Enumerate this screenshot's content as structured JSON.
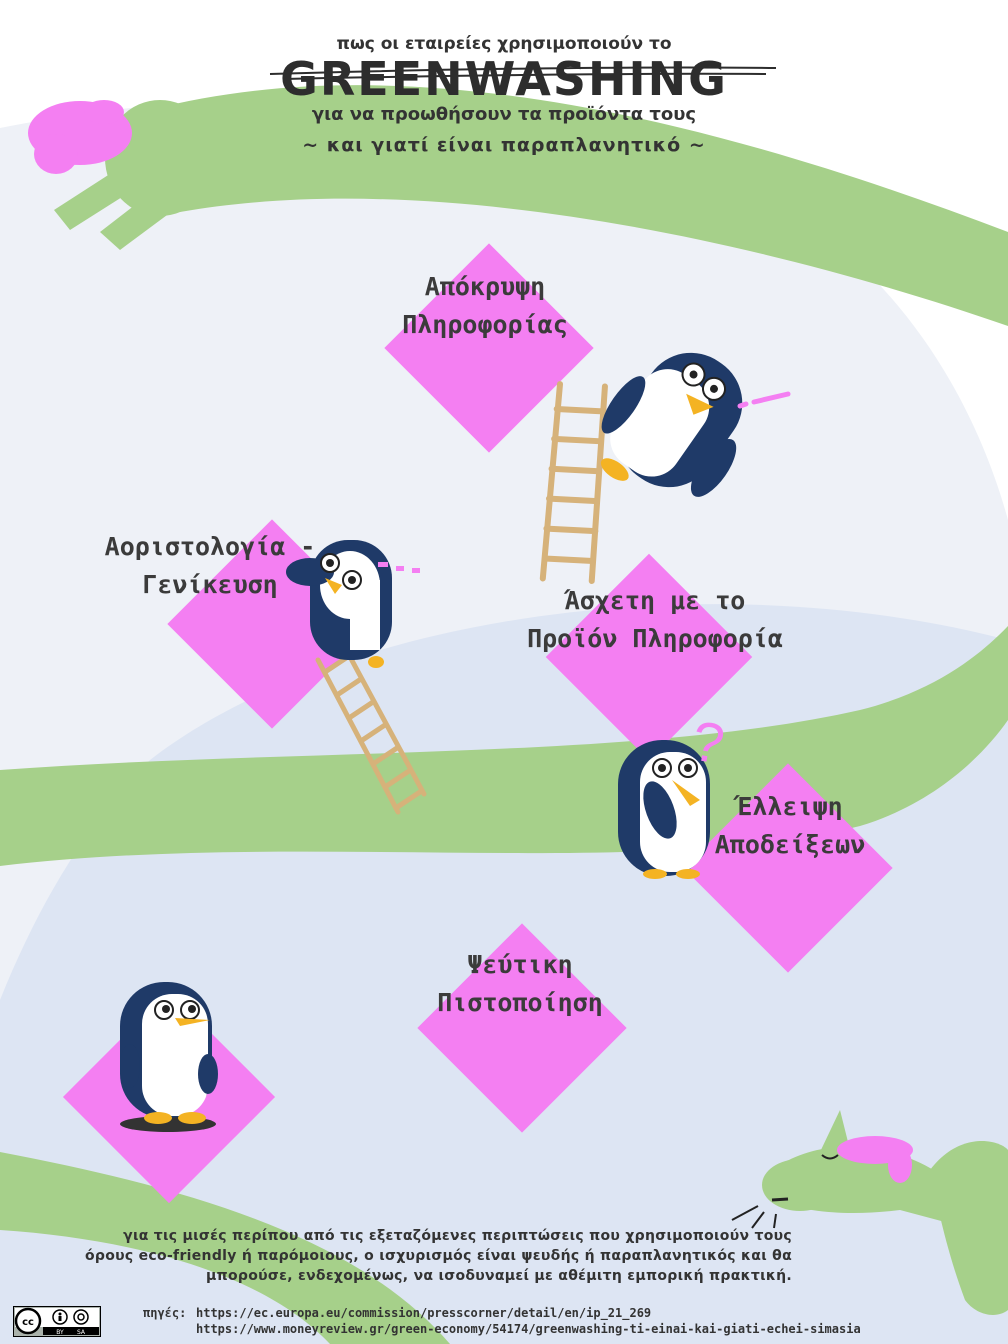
{
  "header": {
    "title_top": "πως οι εταιρείες χρησιμοποιούν το",
    "title_main": "GREENWASHING",
    "title_sub": "για να προωθήσουν τα προϊόντα τους",
    "tagline": "~ και γιατί είναι παραπλανητικό ~"
  },
  "tactics": [
    {
      "line1": "Απόκρυψη",
      "line2": "Πληροφορίας"
    },
    {
      "line1": "Αοριστολογία -",
      "line2": "Γενίκευση"
    },
    {
      "line1": "Άσχετη με το",
      "line2": "Προϊόν Πληροφορία"
    },
    {
      "line1": "Έλλειψη",
      "line2": "Αποδείξεων"
    },
    {
      "line1": "Ψεύτικη",
      "line2": "Πιστοποίηση"
    }
  ],
  "footnote": "για τις μισές περίπου από τις εξεταζόμενες περιπτώσεις που χρησιμοποιούν τους όρους eco-friendly ή παρόμοιους, ο ισχυρισμός είναι ψευδής ή παραπλανητικός και θα μπορούσε, ενδεχομένως, να ισοδυναμεί με αθέμιτη εμπορική πρακτική.",
  "sources": {
    "label": "πηγές:",
    "items": [
      "https://ec.europa.eu/commission/presscorner/detail/en/ip_21_269",
      "https://www.moneyreview.gr/green-economy/54174/greenwashing-ti-einai-kai-giati-echei-simasia"
    ]
  },
  "license": {
    "top": "cc",
    "by": "BY",
    "sa": "SA"
  },
  "decorations": {
    "question_mark": "?"
  },
  "colors": {
    "snake_green": "#a6d08a",
    "diamond_pink": "#f47ff2",
    "hill_back": "#eef1f7",
    "hill_front": "#dde5f3",
    "penguin_navy": "#1f3a68",
    "beak_orange": "#f4b323",
    "ladder": "#d6b27a"
  }
}
